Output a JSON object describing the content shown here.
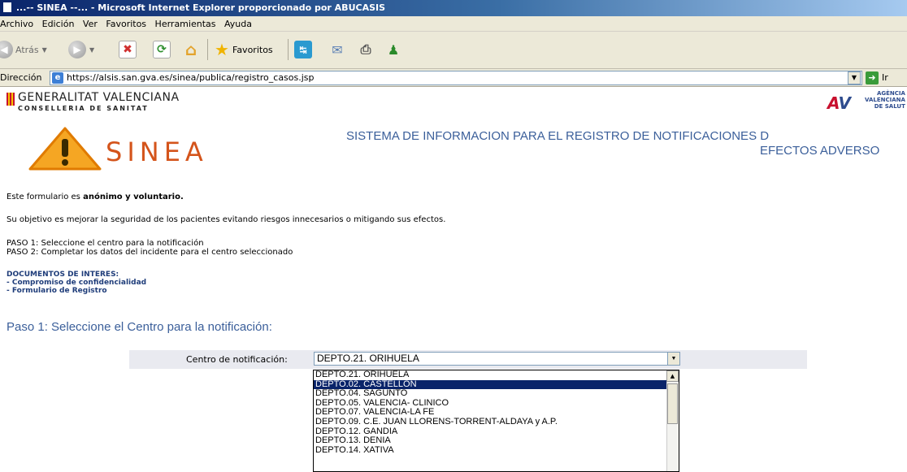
{
  "window": {
    "title": "...-- SINEA --... - Microsoft Internet Explorer proporcionado por ABUCASIS"
  },
  "menu": [
    "Archivo",
    "Edición",
    "Ver",
    "Favoritos",
    "Herramientas",
    "Ayuda"
  ],
  "toolbar": {
    "back_label": "Atrás",
    "favorites_label": "Favoritos"
  },
  "address": {
    "label": "Dirección",
    "url": "https://alsis.san.gva.es/sinea/publica/registro_casos.jsp",
    "go_label": "Ir"
  },
  "header": {
    "gva_line1": "GENERALITAT VALENCIANA",
    "gva_line2": "CONSELLERIA DE SANITAT",
    "avs_line1": "AGÈNCIA",
    "avs_line2": "VALENCIANA",
    "avs_line3": "DE SALUT",
    "sinea": "SINEA",
    "system_title_line1": "SISTEMA DE INFORMACION PARA EL REGISTRO DE NOTIFICACIONES D",
    "system_title_line2": "EFECTOS ADVERSO"
  },
  "form_text": {
    "intro_prefix": "Este formulario es ",
    "intro_bold": "anónimo y voluntario.",
    "objective": "Su objetivo es mejorar la seguridad de los pacientes evitando riesgos innecesarios o mitigando sus efectos.",
    "step1": "PASO 1: Seleccione el centro para la notificación",
    "step2": "PASO 2: Completar los datos del incidente para el centro seleccionado",
    "docs_title": "DOCUMENTOS DE INTERES:",
    "doc_links": [
      "- Compromiso de confidencialidad",
      "- Formulario de Registro"
    ],
    "paso_heading": "Paso 1: Seleccione el Centro para la notificación:"
  },
  "centro": {
    "label": "Centro de notificación:",
    "selected_value": "DEPTO.21. ORIHUELA",
    "options": [
      "DEPTO.21. ORIHUELA",
      "DEPTO.02. CASTELLON",
      "DEPTO.04. SAGUNTO",
      "DEPTO.05. VALENCIA- CLINICO",
      "DEPTO.07. VALENCIA-LA FE",
      "DEPTO.09. C.E. JUAN LLORENS-TORRENT-ALDAYA y A.P.",
      "DEPTO.12. GANDIA",
      "DEPTO.13. DENIA",
      "DEPTO.14. XATIVA"
    ],
    "highlighted_index": 1
  }
}
